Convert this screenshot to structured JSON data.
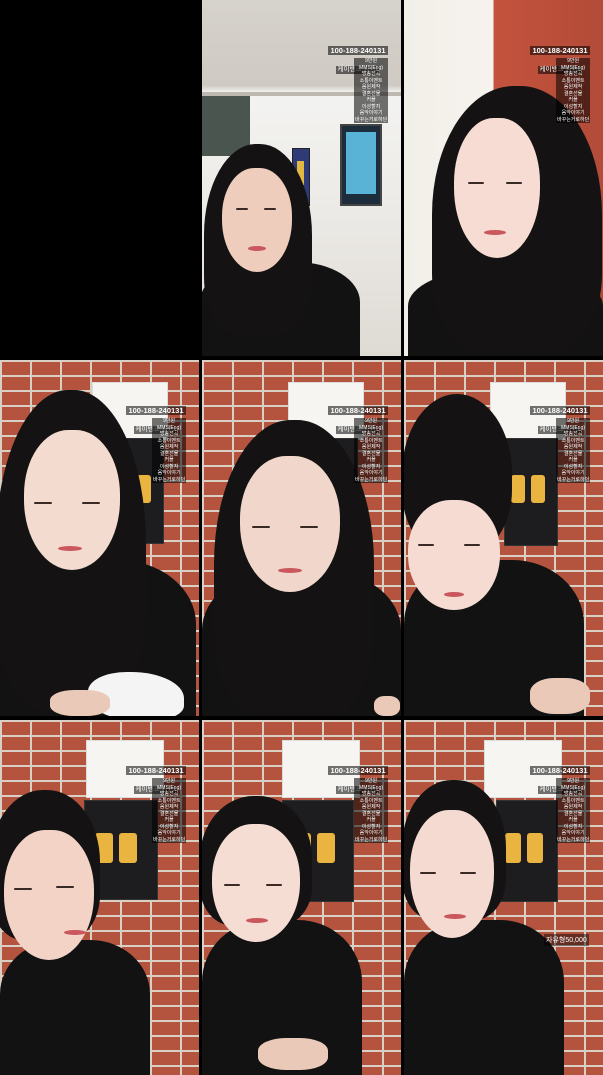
{
  "stream_overlay": {
    "account_number": "100-188-240131",
    "bank_line": "케이뱅크 김민x",
    "price_list": [
      "9만원",
      "MMS(Eng)",
      "방송선곡",
      "소통이벤트",
      "음원제작",
      "결혼선물",
      "커플",
      "이성할지",
      "음악이야기",
      "바꾸는거로하던"
    ]
  },
  "tiles": [
    {
      "id": 1,
      "scene": "empty",
      "has_overlay": false
    },
    {
      "id": 2,
      "scene": "hallway",
      "has_overlay": true
    },
    {
      "id": 3,
      "scene": "room",
      "has_overlay": true
    },
    {
      "id": 4,
      "scene": "brick-wall",
      "has_overlay": true
    },
    {
      "id": 5,
      "scene": "brick-wall",
      "has_overlay": true
    },
    {
      "id": 6,
      "scene": "brick-wall",
      "has_overlay": true
    },
    {
      "id": 7,
      "scene": "brick-wall",
      "has_overlay": true
    },
    {
      "id": 8,
      "scene": "brick-wall",
      "has_overlay": true
    },
    {
      "id": 9,
      "scene": "brick-wall",
      "has_overlay": true
    }
  ],
  "tile9_badge": "자유형50,000",
  "colors": {
    "brick": "#b4533e",
    "mortar": "#d9cfc3",
    "overlay_bg": "rgba(0,0,0,0.55)",
    "hair": "#141212",
    "clothing": "#121212"
  }
}
